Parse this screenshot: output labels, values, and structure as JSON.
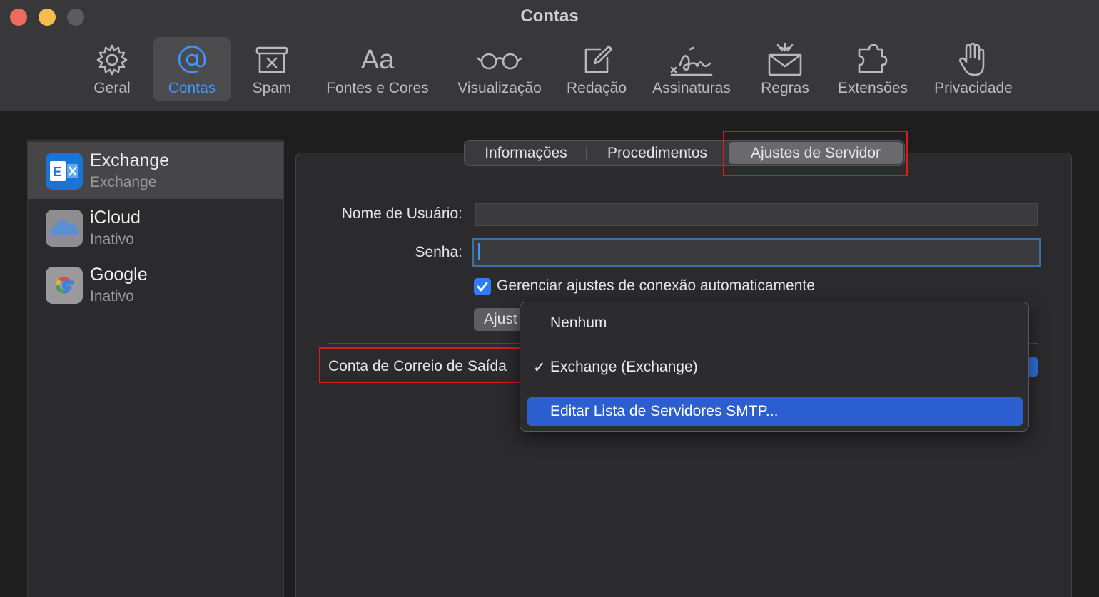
{
  "window": {
    "title": "Contas"
  },
  "toolbar": {
    "items": [
      {
        "label": "Geral",
        "icon": "gear-icon"
      },
      {
        "label": "Contas",
        "icon": "at-sign-icon",
        "active": true
      },
      {
        "label": "Spam",
        "icon": "junk-tray-icon"
      },
      {
        "label": "Fontes e Cores",
        "icon": "font-aa-icon"
      },
      {
        "label": "Visualização",
        "icon": "glasses-icon"
      },
      {
        "label": "Redação",
        "icon": "compose-icon"
      },
      {
        "label": "Assinaturas",
        "icon": "signature-icon"
      },
      {
        "label": "Regras",
        "icon": "rules-envelope-icon"
      },
      {
        "label": "Extensões",
        "icon": "puzzle-icon"
      },
      {
        "label": "Privacidade",
        "icon": "hand-icon"
      }
    ]
  },
  "accounts": [
    {
      "name": "Exchange",
      "status": "Exchange",
      "icon": "exchange-logo-icon",
      "selected": true
    },
    {
      "name": "iCloud",
      "status": "Inativo",
      "icon": "icloud-logo-icon"
    },
    {
      "name": "Google",
      "status": "Inativo",
      "icon": "google-logo-icon"
    }
  ],
  "tabs": [
    {
      "label": "Informações"
    },
    {
      "label": "Procedimentos"
    },
    {
      "label": "Ajustes de Servidor",
      "active": true
    }
  ],
  "form": {
    "username_label": "Nome de Usuário:",
    "username_value": "",
    "password_label": "Senha:",
    "password_value": "",
    "auto_manage_label": "Gerenciar ajustes de conexão automaticamente",
    "auto_manage_checked": true,
    "settings_button_label": "Ajust",
    "outgoing_label": "Conta de Correio de Saída"
  },
  "dropdown": {
    "items": [
      {
        "label": "Nenhum"
      },
      {
        "label": "Exchange (Exchange)",
        "checked": true,
        "check": "✓"
      },
      {
        "label": "Editar Lista de Servidores SMTP...",
        "highlighted": true
      }
    ]
  },
  "colors": {
    "accent": "#3d96ff",
    "highlight_box": "#d81c1c",
    "menu_selection": "#2b5fcf"
  }
}
